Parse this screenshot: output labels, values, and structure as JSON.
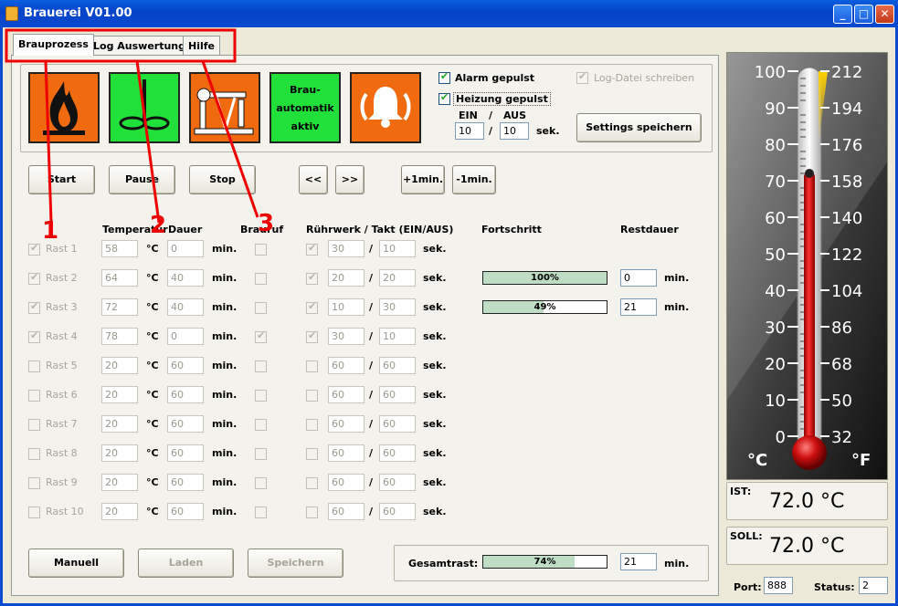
{
  "window": {
    "title": "Brauerei V01.00"
  },
  "tabs": [
    {
      "label": "Brauprozess"
    },
    {
      "label": "Log Auswertung"
    },
    {
      "label": "Hilfe"
    }
  ],
  "status_icons": {
    "automatik_line1": "Brau-",
    "automatik_line2": "automatik",
    "automatik_line3": "aktiv"
  },
  "options": {
    "alarm_label": "Alarm gepulst",
    "heizung_label": "Heizung gepulst",
    "log_label": "Log-Datei schreiben",
    "ein_label": "EIN",
    "slash": "/",
    "aus_label": "AUS",
    "ein_value": "10",
    "aus_value": "10",
    "unit_sec": "sek.",
    "settings_button": "Settings speichern"
  },
  "controls": {
    "start": "Start",
    "pause": "Pause",
    "stop": "Stop",
    "back": "<<",
    "fwd": ">>",
    "plus": "+1min.",
    "minus": "-1min."
  },
  "headers": {
    "temperatur": "Temperatur",
    "dauer": "Dauer",
    "braumruf": "Brauruf",
    "ruehrwerk": "Rührwerk / Takt (EIN/AUS)",
    "fortschritt": "Fortschritt",
    "restdauer": "Restdauer"
  },
  "units": {
    "celsius": "°C",
    "min": "min.",
    "sek": "sek.",
    "slash": "/"
  },
  "rasts": [
    {
      "name": "Rast 1",
      "temp": "58",
      "dauer": "0",
      "ruf": false,
      "ruehr": true,
      "ein": "30",
      "aus": "10"
    },
    {
      "name": "Rast 2",
      "temp": "64",
      "dauer": "40",
      "ruf": false,
      "ruehr": true,
      "ein": "20",
      "aus": "20",
      "progress": 100,
      "progress_label": "100%",
      "rest": "0"
    },
    {
      "name": "Rast 3",
      "temp": "72",
      "dauer": "40",
      "ruf": false,
      "ruehr": true,
      "ein": "10",
      "aus": "30",
      "progress": 49,
      "progress_label": "49%",
      "rest": "21"
    },
    {
      "name": "Rast 4",
      "temp": "78",
      "dauer": "0",
      "ruf": true,
      "ruehr": true,
      "ein": "30",
      "aus": "10"
    },
    {
      "name": "Rast 5",
      "temp": "20",
      "dauer": "60",
      "ruf": false,
      "ruehr": false,
      "ein": "60",
      "aus": "60"
    },
    {
      "name": "Rast 6",
      "temp": "20",
      "dauer": "60",
      "ruf": false,
      "ruehr": false,
      "ein": "60",
      "aus": "60"
    },
    {
      "name": "Rast 7",
      "temp": "20",
      "dauer": "60",
      "ruf": false,
      "ruehr": false,
      "ein": "60",
      "aus": "60"
    },
    {
      "name": "Rast 8",
      "temp": "20",
      "dauer": "60",
      "ruf": false,
      "ruehr": false,
      "ein": "60",
      "aus": "60"
    },
    {
      "name": "Rast 9",
      "temp": "20",
      "dauer": "60",
      "ruf": false,
      "ruehr": false,
      "ein": "60",
      "aus": "60"
    },
    {
      "name": "Rast 10",
      "temp": "20",
      "dauer": "60",
      "ruf": false,
      "ruehr": false,
      "ein": "60",
      "aus": "60"
    }
  ],
  "bottom": {
    "manuell": "Manuell",
    "laden": "Laden",
    "speichern": "Speichern",
    "gesamtrast_label": "Gesamtrast:",
    "gesamt_progress": 74,
    "gesamt_progress_label": "74%",
    "gesamt_rest": "21",
    "unit_min": "min."
  },
  "thermometer": {
    "celsius_ticks": [
      "100",
      "90",
      "80",
      "70",
      "60",
      "50",
      "40",
      "30",
      "20",
      "10",
      "0"
    ],
    "fahrenheit_ticks": [
      "212",
      "194",
      "176",
      "158",
      "140",
      "122",
      "104",
      "86",
      "68",
      "50",
      "32"
    ],
    "celsius_unit": "°C",
    "fahrenheit_unit": "°F",
    "temperature_c": 72.0,
    "target_c": 72.0
  },
  "readouts": {
    "ist_label": "IST:",
    "ist_value": "72.0 °C",
    "soll_label": "SOLL:",
    "soll_value": "72.0 °C",
    "port_label": "Port:",
    "port_value": "888",
    "status_label": "Status:",
    "status_value": "2"
  },
  "annotations": {
    "n1": "1",
    "n2": "2",
    "n3": "3"
  },
  "colors": {
    "orange": "#f06a10",
    "green": "#22e03a",
    "annotation": "#e00000"
  }
}
